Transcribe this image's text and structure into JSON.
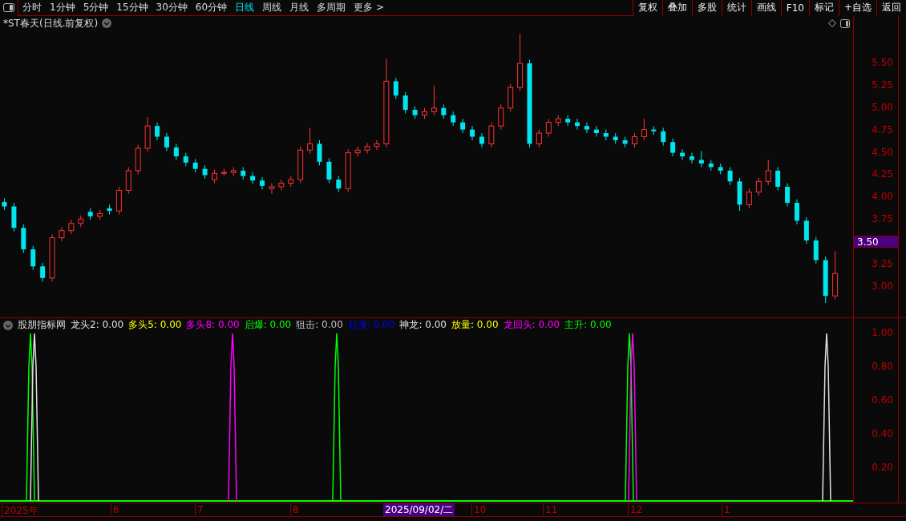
{
  "toolbar": {
    "periods": [
      {
        "label": "分时",
        "selected": false
      },
      {
        "label": "1分钟",
        "selected": false
      },
      {
        "label": "5分钟",
        "selected": false
      },
      {
        "label": "15分钟",
        "selected": false
      },
      {
        "label": "30分钟",
        "selected": false
      },
      {
        "label": "60分钟",
        "selected": false
      },
      {
        "label": "日线",
        "selected": true
      },
      {
        "label": "周线",
        "selected": false
      },
      {
        "label": "月线",
        "selected": false
      },
      {
        "label": "多周期",
        "selected": false
      },
      {
        "label": "更多 >",
        "selected": false
      }
    ],
    "actions": [
      "复权",
      "叠加",
      "多股",
      "统计",
      "画线",
      "F10",
      "标记",
      "+自选",
      "返回"
    ]
  },
  "price_chart": {
    "title": "*ST春天(日线.前复权)",
    "current_price": "3.50",
    "chart_data": {
      "type": "candlestick",
      "ylim": [
        0.58,
        6.02
      ],
      "yticks": [
        {
          "value": 5.5,
          "label": "5.50"
        },
        {
          "value": 5.25,
          "label": "5.25"
        },
        {
          "value": 5.0,
          "label": "5.00"
        },
        {
          "value": 4.75,
          "label": "4.75"
        },
        {
          "value": 4.5,
          "label": "4.50"
        },
        {
          "value": 4.25,
          "label": "4.25"
        },
        {
          "value": 4.0,
          "label": "4.00"
        },
        {
          "value": 3.75,
          "label": "3.75"
        },
        {
          "value": 3.25,
          "label": "3.25"
        },
        {
          "value": 3.0,
          "label": "3.00"
        }
      ],
      "ohlc": [
        [
          3.95,
          3.99,
          3.86,
          3.9
        ],
        [
          3.9,
          3.94,
          3.62,
          3.66
        ],
        [
          3.66,
          3.7,
          3.38,
          3.42
        ],
        [
          3.42,
          3.46,
          3.19,
          3.23
        ],
        [
          3.23,
          3.27,
          3.06,
          3.1
        ],
        [
          3.1,
          3.59,
          3.06,
          3.55
        ],
        [
          3.55,
          3.67,
          3.51,
          3.63
        ],
        [
          3.63,
          3.75,
          3.59,
          3.71
        ],
        [
          3.71,
          3.8,
          3.67,
          3.76
        ],
        [
          3.84,
          3.88,
          3.75,
          3.79
        ],
        [
          3.79,
          3.86,
          3.75,
          3.82
        ],
        [
          3.88,
          3.92,
          3.81,
          3.85
        ],
        [
          3.85,
          4.12,
          3.81,
          4.08
        ],
        [
          4.08,
          4.34,
          4.04,
          4.3
        ],
        [
          4.3,
          4.59,
          4.26,
          4.55
        ],
        [
          4.55,
          4.9,
          4.51,
          4.8
        ],
        [
          4.8,
          4.84,
          4.64,
          4.68
        ],
        [
          4.68,
          4.72,
          4.52,
          4.56
        ],
        [
          4.56,
          4.6,
          4.42,
          4.46
        ],
        [
          4.46,
          4.5,
          4.35,
          4.39
        ],
        [
          4.39,
          4.43,
          4.28,
          4.32
        ],
        [
          4.32,
          4.36,
          4.21,
          4.25
        ],
        [
          4.2,
          4.31,
          4.16,
          4.27
        ],
        [
          4.27,
          4.32,
          4.24,
          4.28
        ],
        [
          4.28,
          4.34,
          4.24,
          4.3
        ],
        [
          4.3,
          4.34,
          4.2,
          4.24
        ],
        [
          4.24,
          4.28,
          4.15,
          4.19
        ],
        [
          4.19,
          4.23,
          4.09,
          4.13
        ],
        [
          4.1,
          4.16,
          4.04,
          4.12
        ],
        [
          4.12,
          4.2,
          4.08,
          4.16
        ],
        [
          4.16,
          4.24,
          4.12,
          4.2
        ],
        [
          4.2,
          4.57,
          4.16,
          4.53
        ],
        [
          4.53,
          4.78,
          4.49,
          4.6
        ],
        [
          4.6,
          4.64,
          4.36,
          4.4
        ],
        [
          4.4,
          4.44,
          4.16,
          4.2
        ],
        [
          4.2,
          4.24,
          4.06,
          4.1
        ],
        [
          4.1,
          4.54,
          4.06,
          4.5
        ],
        [
          4.5,
          4.57,
          4.46,
          4.53
        ],
        [
          4.53,
          4.61,
          4.49,
          4.57
        ],
        [
          4.57,
          4.64,
          4.53,
          4.6
        ],
        [
          4.6,
          5.55,
          4.56,
          5.3
        ],
        [
          5.3,
          5.34,
          5.1,
          5.14
        ],
        [
          5.14,
          5.18,
          4.94,
          4.98
        ],
        [
          4.98,
          5.02,
          4.88,
          4.92
        ],
        [
          4.92,
          5.0,
          4.88,
          4.96
        ],
        [
          4.96,
          5.25,
          4.92,
          5.0
        ],
        [
          5.0,
          5.04,
          4.88,
          4.92
        ],
        [
          4.92,
          4.96,
          4.8,
          4.84
        ],
        [
          4.84,
          4.88,
          4.72,
          4.76
        ],
        [
          4.76,
          4.8,
          4.64,
          4.68
        ],
        [
          4.68,
          4.72,
          4.56,
          4.6
        ],
        [
          4.6,
          4.84,
          4.56,
          4.8
        ],
        [
          4.8,
          5.04,
          4.76,
          5.0
        ],
        [
          5.0,
          5.27,
          4.96,
          5.23
        ],
        [
          5.23,
          5.83,
          5.19,
          5.5
        ],
        [
          5.5,
          5.54,
          4.56,
          4.6
        ],
        [
          4.6,
          4.76,
          4.56,
          4.72
        ],
        [
          4.72,
          4.88,
          4.68,
          4.84
        ],
        [
          4.84,
          4.92,
          4.8,
          4.88
        ],
        [
          4.88,
          4.92,
          4.8,
          4.84
        ],
        [
          4.84,
          4.88,
          4.76,
          4.8
        ],
        [
          4.8,
          4.84,
          4.72,
          4.76
        ],
        [
          4.76,
          4.8,
          4.68,
          4.72
        ],
        [
          4.72,
          4.76,
          4.64,
          4.68
        ],
        [
          4.68,
          4.72,
          4.6,
          4.64
        ],
        [
          4.64,
          4.68,
          4.56,
          4.6
        ],
        [
          4.6,
          4.72,
          4.56,
          4.68
        ],
        [
          4.68,
          4.88,
          4.64,
          4.76
        ],
        [
          4.76,
          4.8,
          4.7,
          4.74
        ],
        [
          4.74,
          4.78,
          4.58,
          4.62
        ],
        [
          4.62,
          4.66,
          4.46,
          4.5
        ],
        [
          4.5,
          4.54,
          4.42,
          4.46
        ],
        [
          4.46,
          4.5,
          4.38,
          4.42
        ],
        [
          4.42,
          4.52,
          4.34,
          4.38
        ],
        [
          4.38,
          4.42,
          4.3,
          4.34
        ],
        [
          4.34,
          4.38,
          4.26,
          4.3
        ],
        [
          4.3,
          4.34,
          4.14,
          4.18
        ],
        [
          4.18,
          4.22,
          3.85,
          3.92
        ],
        [
          3.92,
          4.1,
          3.88,
          4.06
        ],
        [
          4.06,
          4.22,
          4.02,
          4.18
        ],
        [
          4.18,
          4.42,
          4.14,
          4.3
        ],
        [
          4.3,
          4.34,
          4.08,
          4.12
        ],
        [
          4.12,
          4.16,
          3.9,
          3.94
        ],
        [
          3.94,
          3.98,
          3.7,
          3.74
        ],
        [
          3.74,
          3.78,
          3.48,
          3.52
        ],
        [
          3.52,
          3.56,
          3.26,
          3.3
        ],
        [
          3.3,
          3.34,
          2.82,
          2.9
        ],
        [
          2.9,
          3.4,
          2.86,
          3.15
        ]
      ]
    }
  },
  "indicator": {
    "name": "股朋指标网",
    "legend": [
      {
        "label": "龙头2: 0.00",
        "color": "#e0e0e0"
      },
      {
        "label": "多头5: 0.00",
        "color": "#ffff00"
      },
      {
        "label": "多头8: 0.00",
        "color": "#ff00ff"
      },
      {
        "label": "启爆: 0.00",
        "color": "#00ff00"
      },
      {
        "label": "狙击: 0.00",
        "color": "#c0c0c0"
      },
      {
        "label": "起涨: 0.00",
        "color": "#0000ff"
      },
      {
        "label": "神龙: 0.00",
        "color": "#e0e0e1"
      },
      {
        "label": "放量: 0.00",
        "color": "#fffe00"
      },
      {
        "label": "龙回头: 0.00",
        "color": "#ff00fe"
      },
      {
        "label": "主升: 0.00",
        "color": "#00fe00"
      }
    ],
    "yticks": [
      "1.00",
      "0.80",
      "0.60",
      "0.40",
      "0.20"
    ]
  },
  "date_axis": {
    "labels": [
      "2025年",
      "6",
      "7",
      "8",
      "10",
      "11",
      "12",
      "1"
    ],
    "cursor_date": "2025/09/02/二"
  }
}
